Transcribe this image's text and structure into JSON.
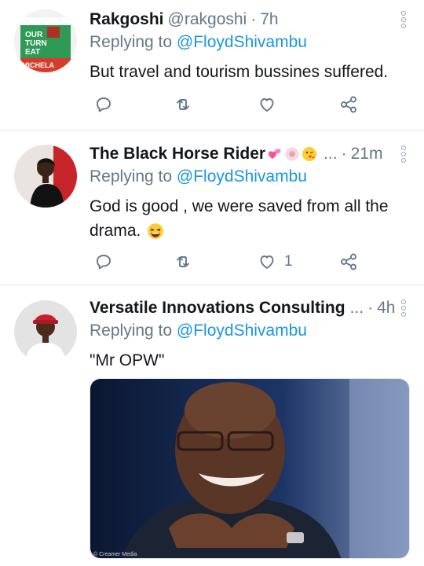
{
  "tweets": [
    {
      "name": "Rakgoshi",
      "handle": "@rakgoshi",
      "time": "7h",
      "replying_prefix": "Replying to",
      "replying_to": "@FloydShivambu",
      "text": "But travel and tourism bussines suffered.",
      "avatar_text": [
        "OUR",
        "TURN",
        "EAT",
        "MICHELA"
      ],
      "actions": {
        "reply": "reply-icon",
        "retweet": "retweet-icon",
        "like": "heart-icon",
        "like_count": "",
        "share": "share-icon"
      }
    },
    {
      "name": "The Black Horse Rider",
      "ellipsis": "...",
      "time": "21m",
      "replying_prefix": "Replying to",
      "replying_to": "@FloydShivambu",
      "text": "God is good , we were saved from all the drama.",
      "actions": {
        "reply": "reply-icon",
        "retweet": "retweet-icon",
        "like": "heart-icon",
        "like_count": "1",
        "share": "share-icon"
      }
    },
    {
      "name": "Versatile Innovations Consulting",
      "ellipsis": "...",
      "time": "4h",
      "replying_prefix": "Replying to",
      "replying_to": "@FloydShivambu",
      "text": "\"Mr OPW\"",
      "media_credit": "© Creamer Media"
    }
  ],
  "colors": {
    "text": "#14171a",
    "muted": "#657786",
    "link": "#1b95e0",
    "divider": "#e1e8ed"
  }
}
